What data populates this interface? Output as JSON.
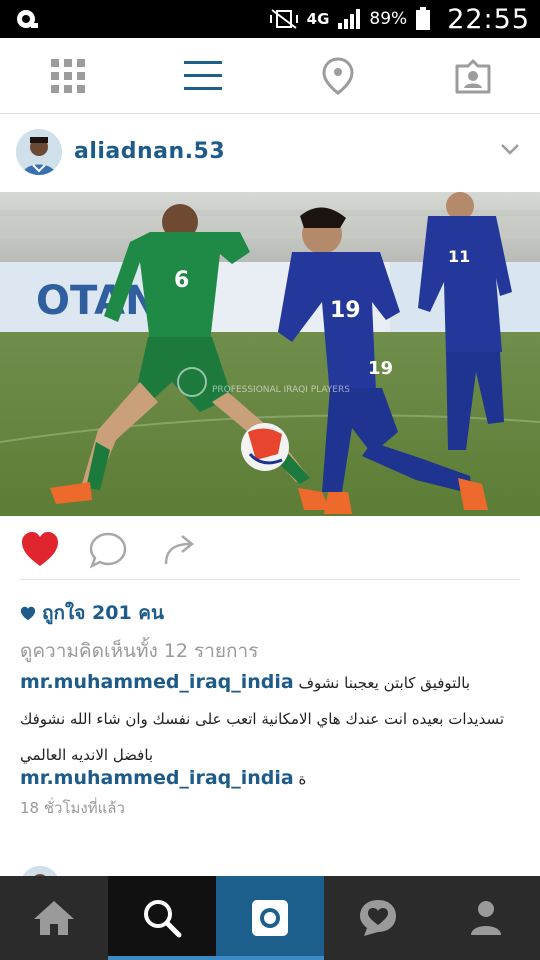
{
  "status_bar": {
    "network": "4G",
    "battery": "89%",
    "time": "22:55",
    "icons": [
      "notification-icon",
      "mute-vibrate-icon",
      "signal-icon",
      "battery-icon"
    ]
  },
  "top_nav": {
    "items": [
      {
        "name": "grid-view-icon"
      },
      {
        "name": "list-view-icon",
        "active": true
      },
      {
        "name": "location-icon"
      },
      {
        "name": "tagged-photos-icon"
      }
    ],
    "accent": "#1d5f8c"
  },
  "post": {
    "username": "aliadnan.53",
    "photo_watermark": "PROFESSIONAL IRAQI PLAYERS",
    "banner_text": "OTAN",
    "likes_text": "ถูกใจ 201 คน",
    "view_comments": "ดูความคิดเห็นทั้ง 12 รายการ",
    "comments": [
      {
        "user": "mr.muhammed_iraq_india",
        "text": "بالتوفيق كابتن يعجبنا نشوف تسديدات بعيده انت عندك هاي الامكانية اتعب على نفسك وان شاء الله نشوفك بافضل الانديه العالمي"
      },
      {
        "user": "mr.muhammed_iraq_india",
        "text": "ة"
      }
    ],
    "time_ago": "18 ชั่วโมงที่แล้ว",
    "liked": true
  },
  "colors": {
    "link": "#1d5b8a",
    "like": "#e0252e",
    "muted": "#9a9a9a"
  },
  "bottom_nav": {
    "items": [
      {
        "name": "home-icon"
      },
      {
        "name": "search-icon",
        "active": true
      },
      {
        "name": "camera-icon"
      },
      {
        "name": "activity-heart-icon"
      },
      {
        "name": "profile-icon"
      }
    ]
  }
}
